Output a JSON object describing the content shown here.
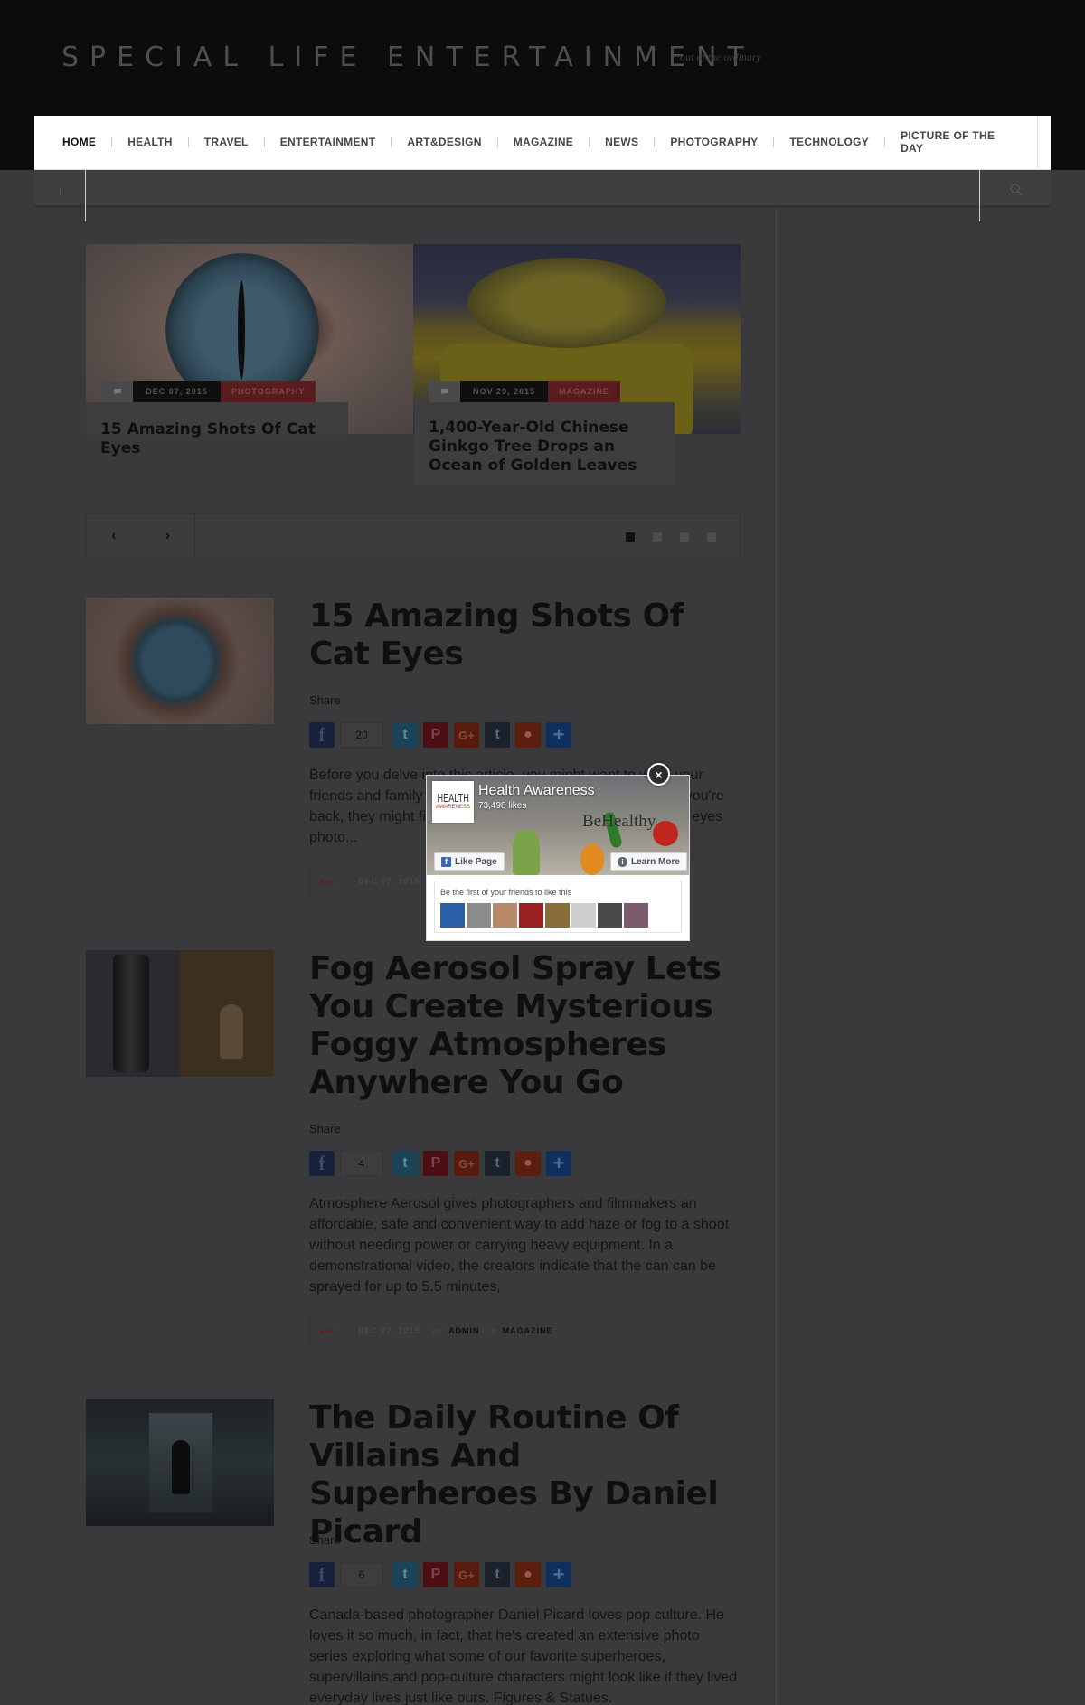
{
  "site": {
    "title": "SPECIAL LIFE ENTERTAINMENT",
    "tagline": "out of the ordinary"
  },
  "nav": {
    "items": [
      "HOME",
      "HEALTH",
      "TRAVEL",
      "ENTERTAINMENT",
      "ART&DESIGN",
      "MAGAZINE",
      "NEWS",
      "PHOTOGRAPHY",
      "TECHNOLOGY",
      "PICTURE OF THE DAY"
    ],
    "active": "HOME"
  },
  "slider": {
    "slides": [
      {
        "comments_icon": "comment-icon",
        "date": "DEC 07, 2015",
        "category": "PHOTOGRAPHY",
        "title": "15 Amazing Shots Of Cat Eyes"
      },
      {
        "comments_icon": "comment-icon",
        "date": "NOV 29, 2015",
        "category": "MAGAZINE",
        "title": "1,400-Year-Old Chinese Ginkgo Tree Drops an Ocean of Golden Leaves"
      }
    ],
    "prev": "‹",
    "next": "›",
    "dot_count": 4,
    "active_dot": 1
  },
  "posts": [
    {
      "title": "15 Amazing Shots Of Cat Eyes",
      "share_label": "Share",
      "share_count": "20",
      "excerpt": "Before you delve into this article, you might want to warn your friends and family that you'll be gone for a while, and once you're back, they might find you mesmerized... in this amazing cat eyes photo...",
      "more": "•••",
      "date": "DEC 07, 2015"
    },
    {
      "title": "Fog Aerosol Spray Lets You Create Mysterious Foggy Atmospheres Anywhere You Go",
      "share_label": "Share",
      "share_count": "4",
      "excerpt": "Atmosphere Aerosol gives photographers and filmmakers an affordable, safe and convenient way to add haze or fog to a shoot without needing power or carrying heavy equipment. In a demonstrational video, the creators indicate that the can can be sprayed for up to 5.5 minutes,",
      "more": "•••",
      "date": "DEC 07, 2015",
      "by_label": "by",
      "author": "ADMIN",
      "in_label": "in",
      "category": "MAGAZINE"
    },
    {
      "title": "The Daily Routine Of Villains And Superheroes By Daniel Picard",
      "share_label": "Share",
      "share_count": "6",
      "excerpt": "Canada-based photographer Daniel Picard loves pop culture. He loves it so much, in fact, that he's created an extensive photo series exploring what some of our favorite superheroes, supervillains and pop-culture characters might look like if they lived everyday lives just like ours. Figures & Statues."
    }
  ],
  "share_buttons": [
    "facebook-icon",
    "twitter-icon",
    "pinterest-icon",
    "google-plus-icon",
    "tumblr-icon",
    "reddit-icon",
    "add-more-icon"
  ],
  "popup": {
    "close": "×",
    "avatar_line1": "HEALTH",
    "avatar_line2": "AWARENESS",
    "page_name": "Health Awareness",
    "likes": "73,498 likes",
    "brand": "BeHealthy",
    "like_button": "Like Page",
    "learn_button": "Learn More",
    "friends_text": "Be the first of your friends to like this",
    "face_colors": [
      "#2b5fa8",
      "#8c8c8c",
      "#b98a6a",
      "#9a1f22",
      "#8a6e3a",
      "#cfcfcf",
      "#4a4a4a",
      "#7a5a6a"
    ]
  },
  "colors": {
    "accent_red": "#5a1d1f",
    "header_bg": "#0c0c0e",
    "overlay_bg": "#3a3a3c"
  }
}
